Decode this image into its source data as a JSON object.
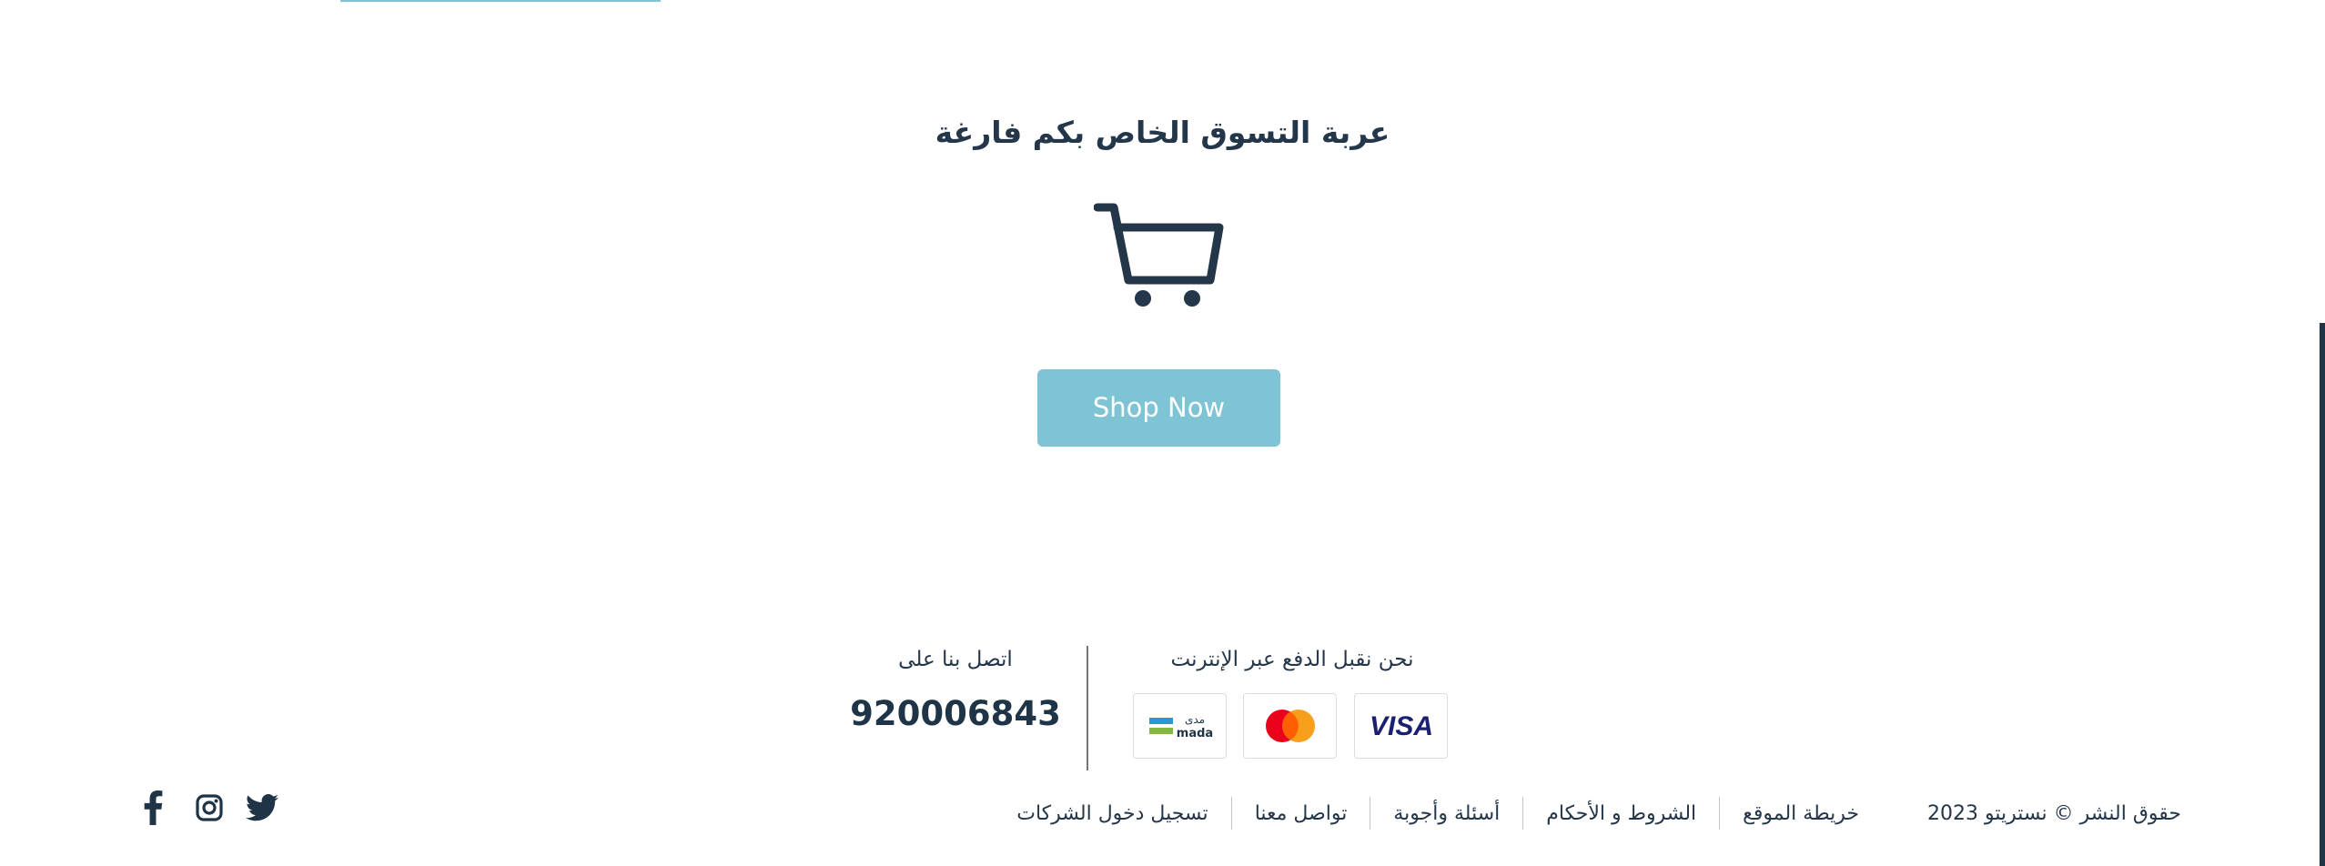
{
  "cart": {
    "empty_message": "عربة التسوق الخاص بكم فارغة",
    "shop_button": "Shop Now"
  },
  "footer": {
    "payment_title": "نحن نقبل الدفع عبر الإنترنت",
    "payment_methods": [
      {
        "name": "VISA"
      },
      {
        "name": "Mastercard"
      },
      {
        "name": "mada",
        "label": "mada",
        "label_ar": "مدى"
      }
    ],
    "contact_title": "اتصل بنا على",
    "phone": "920006843",
    "copyright": "حقوق النشر © نستريتو 2023",
    "links": [
      "خريطة الموقع",
      "الشروط و الأحكام",
      "أسئلة وأجوبة",
      "تواصل معنا",
      "تسجيل دخول الشركات"
    ],
    "social": [
      "twitter-icon",
      "instagram-icon",
      "facebook-icon"
    ]
  },
  "colors": {
    "accent": "#7fc4d4",
    "text": "#1f3547",
    "visa_blue": "#1a1f71",
    "mc_red": "#eb001b",
    "mc_orange": "#f79e1b",
    "mada_blue": "#259bd6",
    "mada_green": "#84b740"
  }
}
